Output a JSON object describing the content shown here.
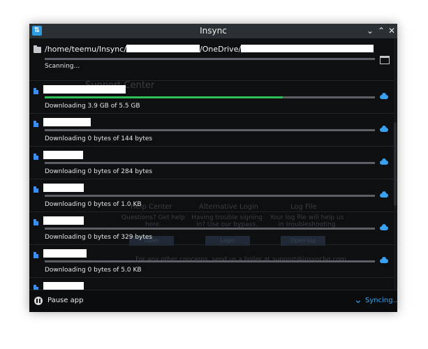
{
  "window": {
    "title": "Insync",
    "app_icon_glyph": "⇅",
    "buttons": [
      "chevron-down-icon",
      "chevron-up-icon",
      "close-icon"
    ]
  },
  "path_row": {
    "path_prefix": "/home/teemu/Insync/",
    "path_middle": "/OneDrive/",
    "scan_label": "Scanning..."
  },
  "files": [
    {
      "status": "Downloading 3.9 GB of 5.5 GB",
      "progress": 0.72
    },
    {
      "status": "Downloading 0 bytes of 144 bytes",
      "progress": 0
    },
    {
      "status": "Downloading 0 bytes of 284 bytes",
      "progress": 0
    },
    {
      "status": "Downloading 0 bytes of 1.0 KB",
      "progress": 0
    },
    {
      "status": "Downloading 0 bytes of 329 bytes",
      "progress": 0
    },
    {
      "status": "Downloading 0 bytes of 5.0 KB",
      "progress": 0
    },
    {
      "status": "",
      "progress": 0
    }
  ],
  "background": {
    "support_title": "Support Center",
    "help_center": "Help Center",
    "help_desc": "Questions? Get help here.",
    "alt_login": "Alternative Login",
    "alt_desc": "Having trouble signing in? Use our bypass.",
    "log_file": "Log File",
    "log_desc": "Your log file will help us in troubleshooting",
    "btn_open": "Open",
    "btn_login": "Login",
    "btn_open_log": "Open log",
    "footer_note": "For any other concerns, send us a holler at support@insynchq.com"
  },
  "footer": {
    "pause_label": "Pause app",
    "sync_label": "Syncing...",
    "sync_icon": "⌄"
  },
  "colors": {
    "accent": "#3aa6f2",
    "progress_fill": "#2fbf5a",
    "file_icon": "#3a8ff0"
  }
}
